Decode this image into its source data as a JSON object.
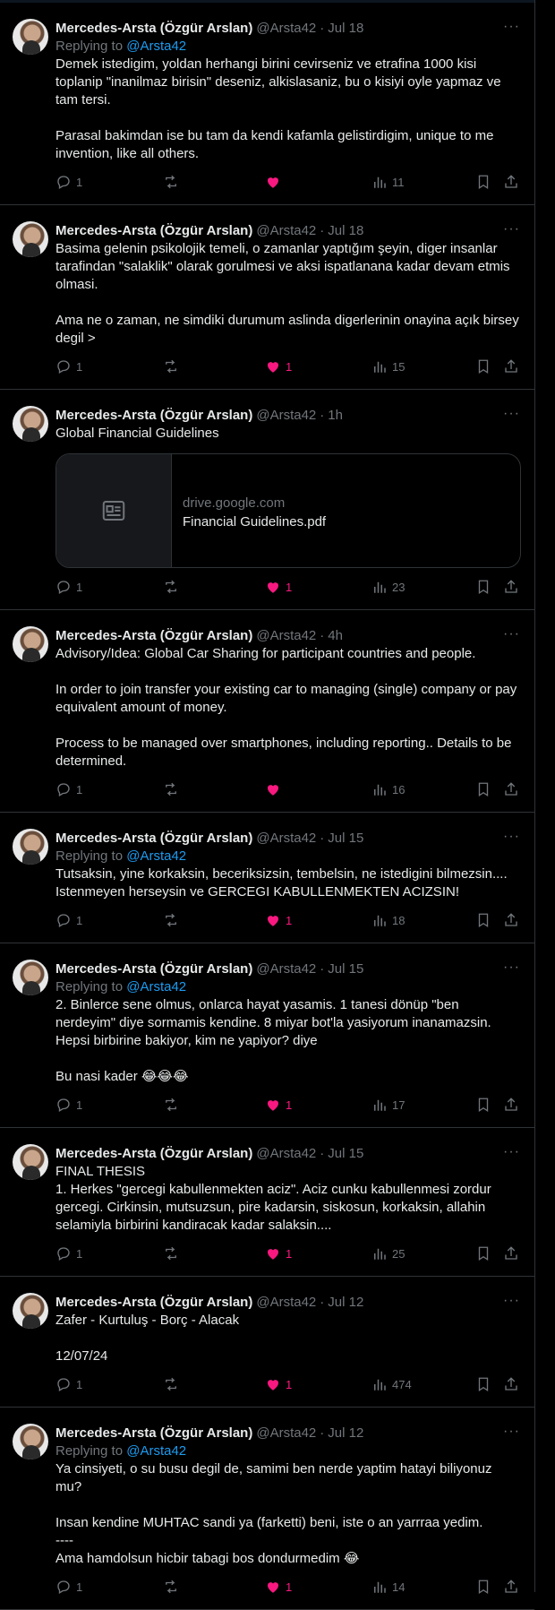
{
  "tweets": [
    {
      "name": "Mercedes-Arsta (Özgür Arslan)",
      "handle": "@Arsta42",
      "time": "Jul 18",
      "replying_prefix": "Replying to ",
      "replying_to": "@Arsta42",
      "text": "Demek istedigim, yoldan herhangi birini cevirseniz ve etrafina 1000 kisi toplanip \"inanilmaz birisin\" deseniz, alkislasaniz, bu o kisiyi oyle yapmaz ve tam tersi.\n\nParasal bakimdan ise bu tam da kendi kafamla gelistirdigim, unique to me invention, like all others.",
      "replies": "1",
      "retweets": "",
      "likes": "",
      "views": "11",
      "liked": true
    },
    {
      "name": "Mercedes-Arsta (Özgür Arslan)",
      "handle": "@Arsta42",
      "time": "Jul 18",
      "text": "Basima gelenin psikolojik temeli, o zamanlar yaptığım şeyin, diger insanlar tarafindan \"salaklik\" olarak gorulmesi ve aksi ispatlanana kadar devam etmis olmasi.\n\nAma ne o zaman, ne simdiki durumum aslinda digerlerinin onayina açık birsey degil >",
      "replies": "1",
      "retweets": "",
      "likes": "1",
      "views": "15",
      "liked": true
    },
    {
      "name": "Mercedes-Arsta (Özgür Arslan)",
      "handle": "@Arsta42",
      "time": "1h",
      "text": "Global Financial Guidelines",
      "card": {
        "domain": "drive.google.com",
        "title": "Financial Guidelines.pdf"
      },
      "replies": "1",
      "retweets": "",
      "likes": "1",
      "views": "23",
      "liked": true
    },
    {
      "name": "Mercedes-Arsta (Özgür Arslan)",
      "handle": "@Arsta42",
      "time": "4h",
      "text": "Advisory/Idea: Global Car Sharing for participant countries and people.\n\nIn order to join transfer your existing car to managing (single) company or pay equivalent amount of money.\n\nProcess to be managed over smartphones, including reporting.. Details to be determined.",
      "replies": "1",
      "retweets": "",
      "likes": "",
      "views": "16",
      "liked": true
    },
    {
      "name": "Mercedes-Arsta (Özgür Arslan)",
      "handle": "@Arsta42",
      "time": "Jul 15",
      "replying_prefix": "Replying to ",
      "replying_to": "@Arsta42",
      "text": "Tutsaksin, yine korkaksin, beceriksizsin, tembelsin, ne istedigini bilmezsin.... Istenmeyen herseysin ve  GERCEGI KABULLENMEKTEN ACIZSIN!",
      "replies": "1",
      "retweets": "",
      "likes": "1",
      "views": "18",
      "liked": true
    },
    {
      "name": "Mercedes-Arsta (Özgür Arslan)",
      "handle": "@Arsta42",
      "time": "Jul 15",
      "replying_prefix": "Replying to ",
      "replying_to": "@Arsta42",
      "text": "2. Binlerce sene olmus, onlarca hayat yasamis. 1 tanesi dönüp \"ben nerdeyim\" diye sormamis kendine. 8 miyar bot'la yasiyorum inanamazsin. Hepsi birbirine bakiyor, kim ne yapiyor? diye\n\nBu nasi kader 😂😂😂",
      "replies": "1",
      "retweets": "",
      "likes": "1",
      "views": "17",
      "liked": true
    },
    {
      "name": "Mercedes-Arsta (Özgür Arslan)",
      "handle": "@Arsta42",
      "time": "Jul 15",
      "text": "FINAL THESIS\n1. Herkes \"gercegi kabullenmekten aciz\". Aciz cunku kabullenmesi zordur gercegi. Cirkinsin, mutsuzsun, pire kadarsin, siskosun, korkaksin, allahin selamiyla birbirini kandiracak kadar salaksin....",
      "replies": "1",
      "retweets": "",
      "likes": "1",
      "views": "25",
      "liked": true
    },
    {
      "name": "Mercedes-Arsta (Özgür Arslan)",
      "handle": "@Arsta42",
      "time": "Jul 12",
      "text": "Zafer - Kurtuluş - Borç - Alacak\n\n12/07/24",
      "replies": "1",
      "retweets": "",
      "likes": "1",
      "views": "474",
      "liked": true
    },
    {
      "name": "Mercedes-Arsta (Özgür Arslan)",
      "handle": "@Arsta42",
      "time": "Jul 12",
      "replying_prefix": "Replying to ",
      "replying_to": "@Arsta42",
      "text": "Ya cinsiyeti, o su busu degil de, samimi ben nerde yaptim hatayi biliyonuz mu?\n\nInsan kendine MUHTAC sandi ya (farketti) beni, iste o an yarrraa yedim.\n----\nAma hamdolsun hicbir tabagi bos dondurmedim 😂",
      "replies": "1",
      "retweets": "",
      "likes": "1",
      "views": "14",
      "liked": true
    }
  ],
  "colors": {
    "like": "#f91880",
    "link": "#1d9bf0",
    "muted": "#71767b",
    "border": "#2f3336"
  }
}
